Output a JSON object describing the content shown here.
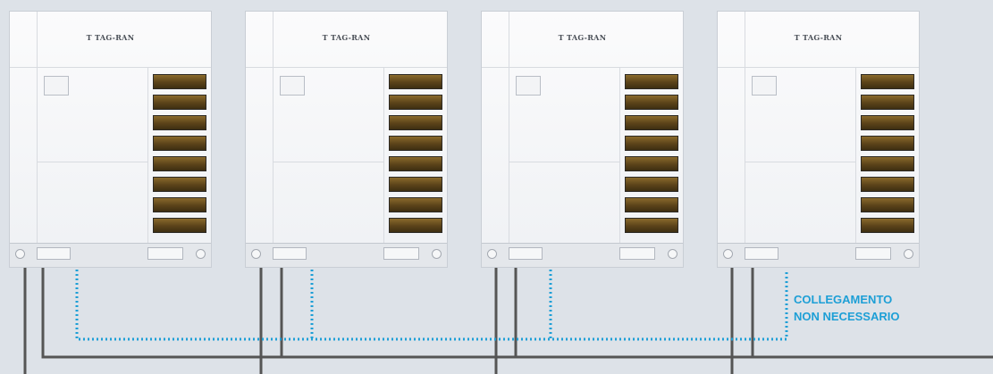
{
  "units": [
    {
      "brand": "T TAG-RAN"
    },
    {
      "brand": "T TAG-RAN"
    },
    {
      "brand": "T TAG-RAN"
    },
    {
      "brand": "T TAG-RAN"
    }
  ],
  "label": {
    "line1": "COLLEGAMENTO",
    "line2": "NON NECESSARIO"
  },
  "colors": {
    "pipe": "#555555",
    "dotted": "#1d9fd6",
    "background": "#dde2e8"
  }
}
